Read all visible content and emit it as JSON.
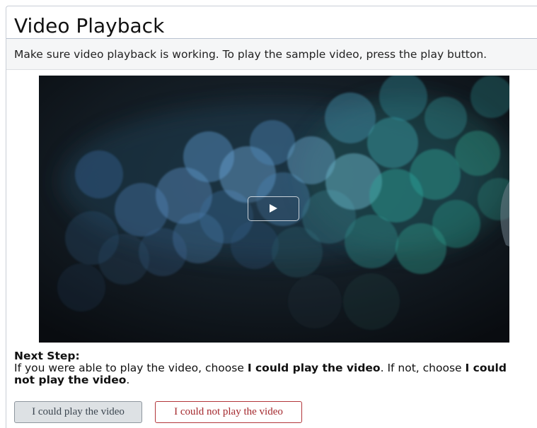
{
  "page": {
    "title": "Video Playback",
    "instructions": "Make sure video playback is working. To play the sample video, press the play button."
  },
  "video": {
    "play_icon": "play-icon",
    "accent_colors": [
      "#4a8fc4",
      "#2f9c96",
      "#0d1217"
    ]
  },
  "next_step": {
    "heading": "Next Step:",
    "text_before": "If you were able to play the video, choose ",
    "option_yes_bold": "I could play the video",
    "text_middle": ". If not, choose ",
    "option_no_bold": "I could not play the video",
    "text_after": "."
  },
  "buttons": {
    "could_play_label": "I could play the video",
    "could_not_play_label": "I could not play the video"
  }
}
